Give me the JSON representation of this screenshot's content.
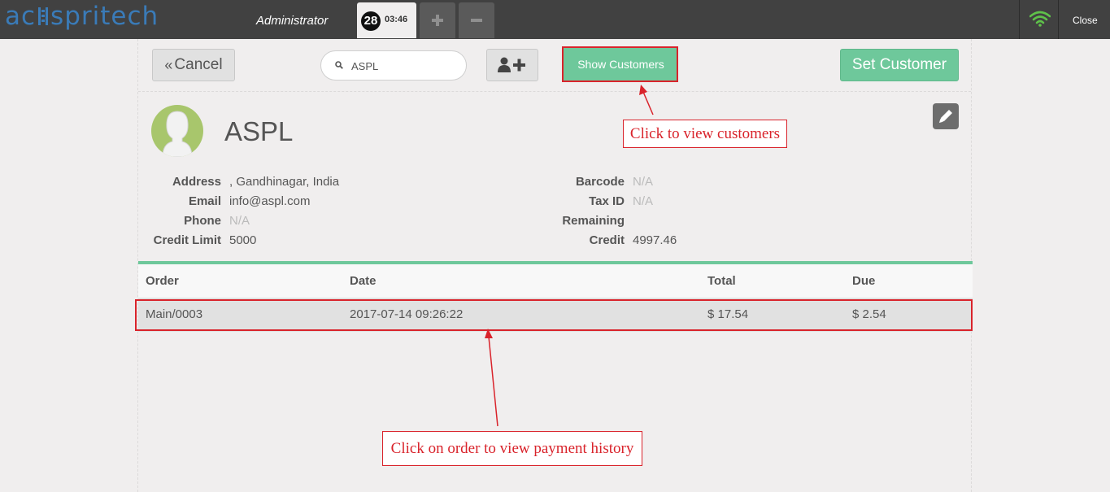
{
  "topbar": {
    "logo_text_left": "ac",
    "logo_text_right": "spritech",
    "cashier": "Administrator",
    "order_number": "28",
    "order_time": "03:46",
    "close_label": "Close"
  },
  "actions": {
    "cancel_label": "Cancel",
    "search_value": "ASPL",
    "show_customers_label": "Show Customers",
    "set_customer_label": "Set Customer"
  },
  "customer": {
    "name": "ASPL",
    "left_fields": [
      {
        "label": "Address",
        "value": ", Gandhinagar, India"
      },
      {
        "label": "Email",
        "value": "info@aspl.com"
      },
      {
        "label": "Phone",
        "value": "N/A"
      },
      {
        "label": "Credit Limit",
        "value": "5000"
      }
    ],
    "right_fields": [
      {
        "label": "Barcode",
        "value": "N/A"
      },
      {
        "label": "Tax ID",
        "value": "N/A"
      },
      {
        "label": "Remaining",
        "value": ""
      },
      {
        "label": "Credit",
        "value": "4997.46"
      }
    ]
  },
  "orders": {
    "columns": [
      "Order",
      "Date",
      "Total",
      "Due"
    ],
    "rows": [
      {
        "order": "Main/0003",
        "date": "2017-07-14 09:26:22",
        "total": "$ 17.54",
        "due": "$ 2.54"
      }
    ]
  },
  "annotations": {
    "customers_note": "Click to view customers",
    "order_note": "Click on order to view payment history"
  },
  "colors": {
    "accent_green": "#6ec89b",
    "topbar": "#414141",
    "annotation_red": "#d9232b",
    "logo_blue": "#3a7bb8"
  },
  "icons": [
    "double-chevron-left-icon",
    "search-icon",
    "add-user-icon",
    "pencil-icon",
    "wifi-icon",
    "plus-icon",
    "minus-icon",
    "avatar-icon"
  ]
}
